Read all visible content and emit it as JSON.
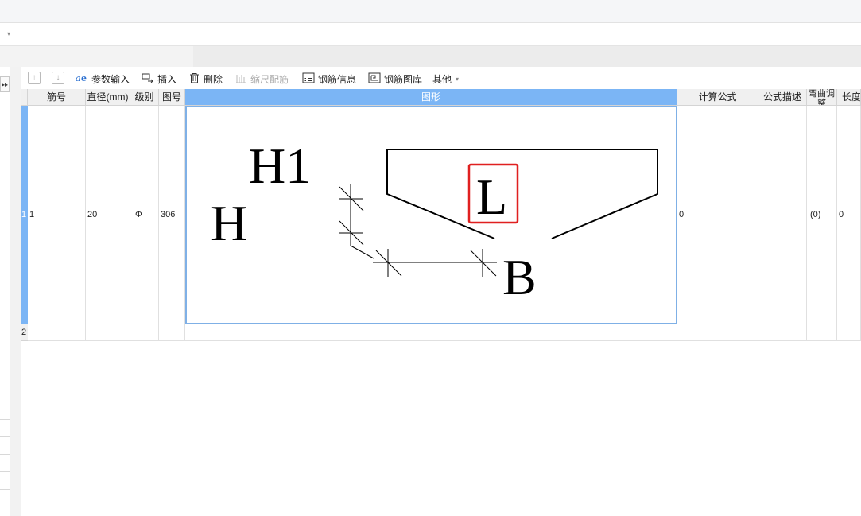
{
  "toolbar": {
    "move_up": "↑",
    "move_down": "↓",
    "param_input": "参数输入",
    "insert": "插入",
    "delete": "删除",
    "scale_rebar": "缩尺配筋",
    "rebar_info": "钢筋信息",
    "rebar_library": "钢筋图库",
    "other": "其他"
  },
  "grid": {
    "headers": {
      "bar_no": "筋号",
      "diameter": "直径(mm)",
      "grade": "级别",
      "shape_no": "图号",
      "shape": "图形",
      "formula": "计算公式",
      "formula_desc": "公式描述",
      "bend_adjust": "弯曲调整",
      "length": "长度"
    },
    "rows": [
      {
        "row_num": "1",
        "bar_no": "1",
        "diameter": "20",
        "grade": "Φ",
        "shape_no": "306",
        "formula": "0",
        "formula_desc": "",
        "bend_adjust": "(0)",
        "length": "0"
      },
      {
        "row_num": "2"
      }
    ]
  },
  "shape_labels": {
    "h": "H",
    "h1": "H1",
    "l": "L",
    "b": "B"
  },
  "colors": {
    "selected_header": "#7bb5f5",
    "highlight_box": "#e02020",
    "shape_border": "#7fb0e6"
  },
  "icons": {
    "param_input": "param-input-icon",
    "insert": "insert-icon",
    "delete": "trash-icon",
    "scale_rebar": "scale-icon",
    "rebar_info": "info-list-icon",
    "rebar_library": "library-icon"
  }
}
